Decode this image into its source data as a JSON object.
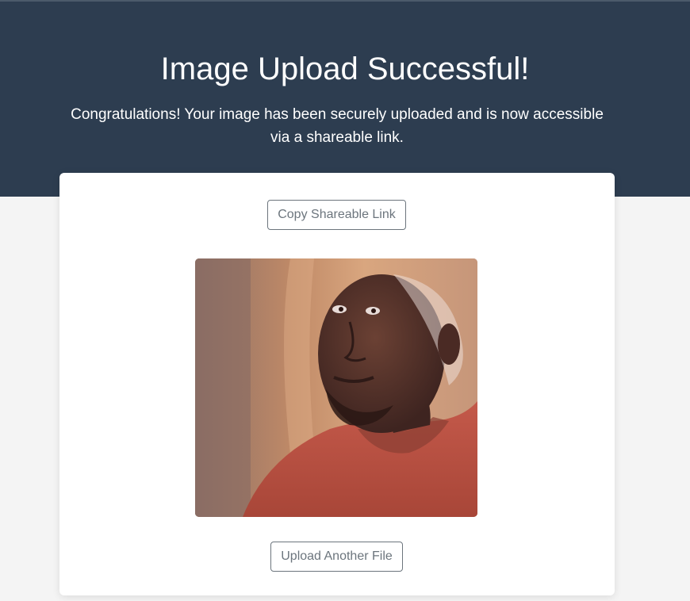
{
  "header": {
    "title": "Image Upload Successful!",
    "message": "Congratulations! Your image has been securely uploaded and is now accessible via a shareable link."
  },
  "card": {
    "copy_button_label": "Copy Shareable Link",
    "upload_button_label": "Upload Another File"
  },
  "colors": {
    "header_background": "#2d3d50",
    "page_background": "#f4f4f4",
    "button_border": "#6c757d"
  }
}
